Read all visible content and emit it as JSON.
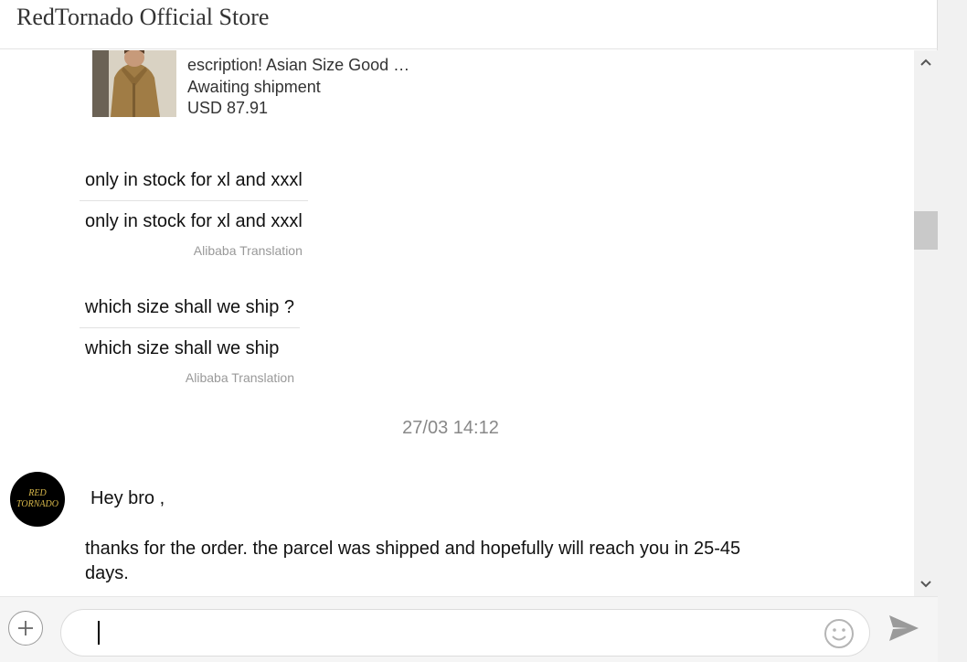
{
  "header": {
    "title": "RedTornado Official Store"
  },
  "product": {
    "name": "escription! Asian Size Good …",
    "status": "Awaiting shipment",
    "price": "USD 87.91"
  },
  "messages": [
    {
      "original": "only in stock for xl and xxxl",
      "translated": "only in stock for xl and xxxl",
      "source": "Alibaba Translation"
    },
    {
      "original": "which size shall we ship ?",
      "translated": "which size shall we ship",
      "source": "Alibaba Translation"
    }
  ],
  "timestamp": "27/03 14:12",
  "seller": {
    "avatar_text_1": "RED",
    "avatar_text_2": "TORNADO",
    "greeting": "Hey bro ,",
    "body": "thanks for the order. the parcel was shipped and hopefully will reach you in 25-45 days."
  },
  "composer": {
    "value": "",
    "placeholder": ""
  },
  "icons": {
    "add": "plus-icon",
    "emoji": "emoji-icon",
    "send": "send-icon",
    "scroll_up": "chevron-up-icon",
    "scroll_down": "chevron-down-icon"
  },
  "colors": {
    "avatar_bg": "#000000",
    "avatar_text": "#d8b84a",
    "muted": "#999999"
  }
}
